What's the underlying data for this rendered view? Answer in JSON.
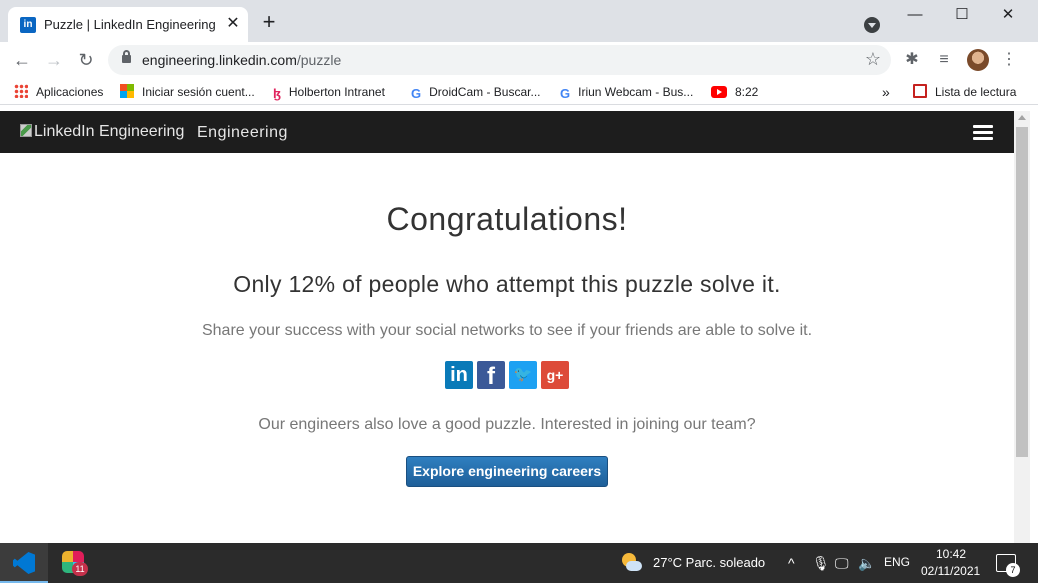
{
  "browser": {
    "tab": {
      "favicon": "in",
      "title": "Puzzle | LinkedIn Engineering",
      "close": "✕"
    },
    "new_tab": "+",
    "window": {
      "minimize": "—",
      "maximize": "☐",
      "close": "✕"
    },
    "toolbar": {
      "back": "←",
      "forward": "→",
      "reload": "↻",
      "url_host": "engineering.linkedin.com",
      "url_path": "/puzzle",
      "star": "☆",
      "extensions": "✱",
      "media": "≡",
      "menu": "⋮"
    },
    "bookmarks": [
      {
        "label": "Aplicaciones",
        "icon": "apps-icon"
      },
      {
        "label": "Iniciar sesión cuent...",
        "icon": "microsoft-icon"
      },
      {
        "label": "Holberton Intranet",
        "icon": "holberton-icon",
        "glyph": "ɮ"
      },
      {
        "label": "DroidCam - Buscar...",
        "icon": "google-icon",
        "glyph": "G"
      },
      {
        "label": "Iriun Webcam - Bus...",
        "icon": "google-icon",
        "glyph": "G"
      },
      {
        "label": "8:22",
        "icon": "youtube-icon"
      }
    ],
    "bookmarks_overflow": "»",
    "reading_list": "Lista de lectura"
  },
  "site": {
    "logo_alt": "LinkedIn Engineering",
    "brand": "Engineering"
  },
  "main": {
    "heading": "Congratulations!",
    "subheading": "Only 12% of people who attempt this puzzle solve it.",
    "share_text": "Share your success with your social networks to see if your friends are able to solve it.",
    "social": {
      "linkedin": "in",
      "facebook": "f",
      "twitter": "🐦",
      "googleplus": "g+"
    },
    "join_text": "Our engineers also love a good puzzle. Interested in joining our team?",
    "cta_label": "Explore engineering careers"
  },
  "taskbar": {
    "slack_badge": "11",
    "weather": "27°C  Parc. soleado",
    "tray_up": "^",
    "language": "ENG",
    "time": "10:42",
    "date": "02/11/2021",
    "notifications": "7"
  }
}
